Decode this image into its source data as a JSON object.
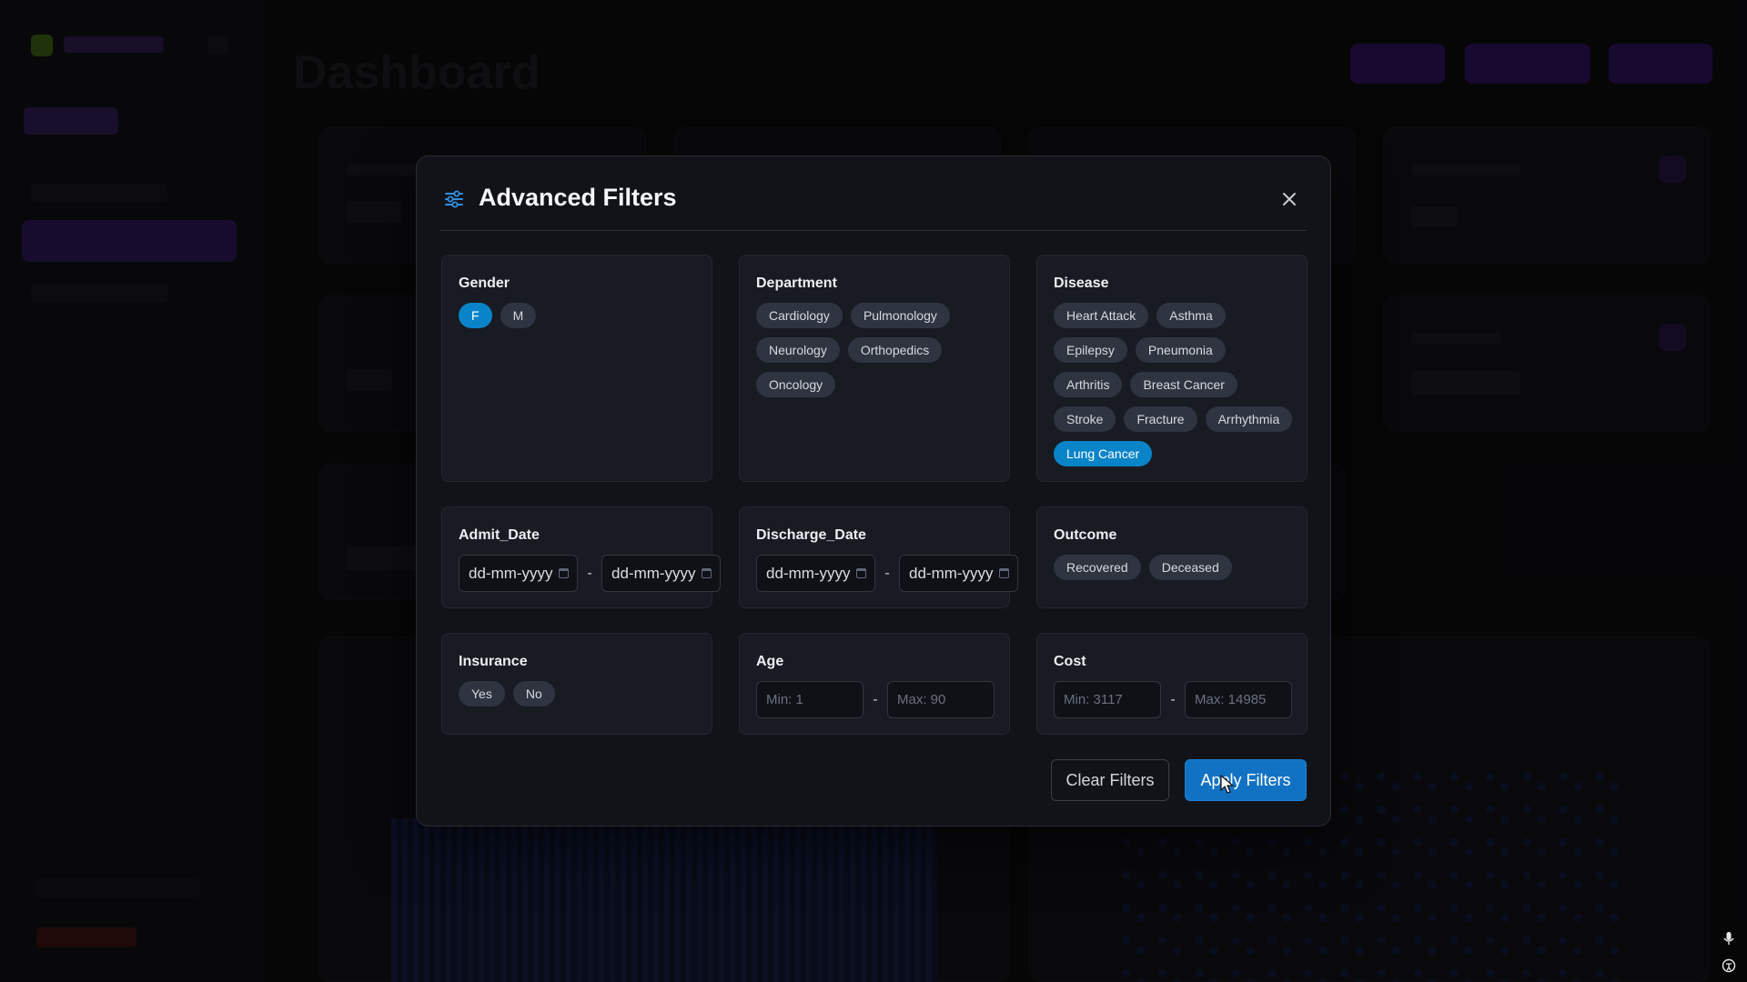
{
  "background": {
    "page_title": "Dashboard"
  },
  "modal": {
    "title": "Advanced Filters",
    "filters": {
      "gender": {
        "label": "Gender",
        "options": [
          {
            "label": "F",
            "selected": true
          },
          {
            "label": "M",
            "selected": false
          }
        ]
      },
      "department": {
        "label": "Department",
        "options": [
          {
            "label": "Cardiology",
            "selected": false
          },
          {
            "label": "Pulmonology",
            "selected": false
          },
          {
            "label": "Neurology",
            "selected": false
          },
          {
            "label": "Orthopedics",
            "selected": false
          },
          {
            "label": "Oncology",
            "selected": false
          }
        ]
      },
      "disease": {
        "label": "Disease",
        "options": [
          {
            "label": "Heart Attack",
            "selected": false
          },
          {
            "label": "Asthma",
            "selected": false
          },
          {
            "label": "Epilepsy",
            "selected": false
          },
          {
            "label": "Pneumonia",
            "selected": false
          },
          {
            "label": "Arthritis",
            "selected": false
          },
          {
            "label": "Breast Cancer",
            "selected": false
          },
          {
            "label": "Stroke",
            "selected": false
          },
          {
            "label": "Fracture",
            "selected": false
          },
          {
            "label": "Arrhythmia",
            "selected": false
          },
          {
            "label": "Lung Cancer",
            "selected": true
          }
        ]
      },
      "admit_date": {
        "label": "Admit_Date",
        "from_placeholder": "dd-mm-yyyy",
        "to_placeholder": "dd-mm-yyyy",
        "separator": "-"
      },
      "discharge_date": {
        "label": "Discharge_Date",
        "from_placeholder": "dd-mm-yyyy",
        "to_placeholder": "dd-mm-yyyy",
        "separator": "-"
      },
      "outcome": {
        "label": "Outcome",
        "options": [
          {
            "label": "Recovered",
            "selected": false
          },
          {
            "label": "Deceased",
            "selected": false
          }
        ]
      },
      "insurance": {
        "label": "Insurance",
        "options": [
          {
            "label": "Yes",
            "selected": false
          },
          {
            "label": "No",
            "selected": false
          }
        ]
      },
      "age": {
        "label": "Age",
        "min_placeholder": "Min: 1",
        "max_placeholder": "Max: 90",
        "separator": "-"
      },
      "cost": {
        "label": "Cost",
        "min_placeholder": "Min: 3117",
        "max_placeholder": "Max: 14985",
        "separator": "-"
      }
    },
    "buttons": {
      "clear_label": "Clear Filters",
      "apply_label": "Apply Filters"
    }
  },
  "colors": {
    "selected_chip": "#0a84c8",
    "apply_button": "#1172c4",
    "accent_purple": "#2a1156"
  },
  "icons": {
    "title_icon": "sliders-icon",
    "close": "close-icon",
    "date_picker": "calendar-icon",
    "corner_top": "microphone-icon",
    "corner_bottom": "accessibility-icon"
  }
}
